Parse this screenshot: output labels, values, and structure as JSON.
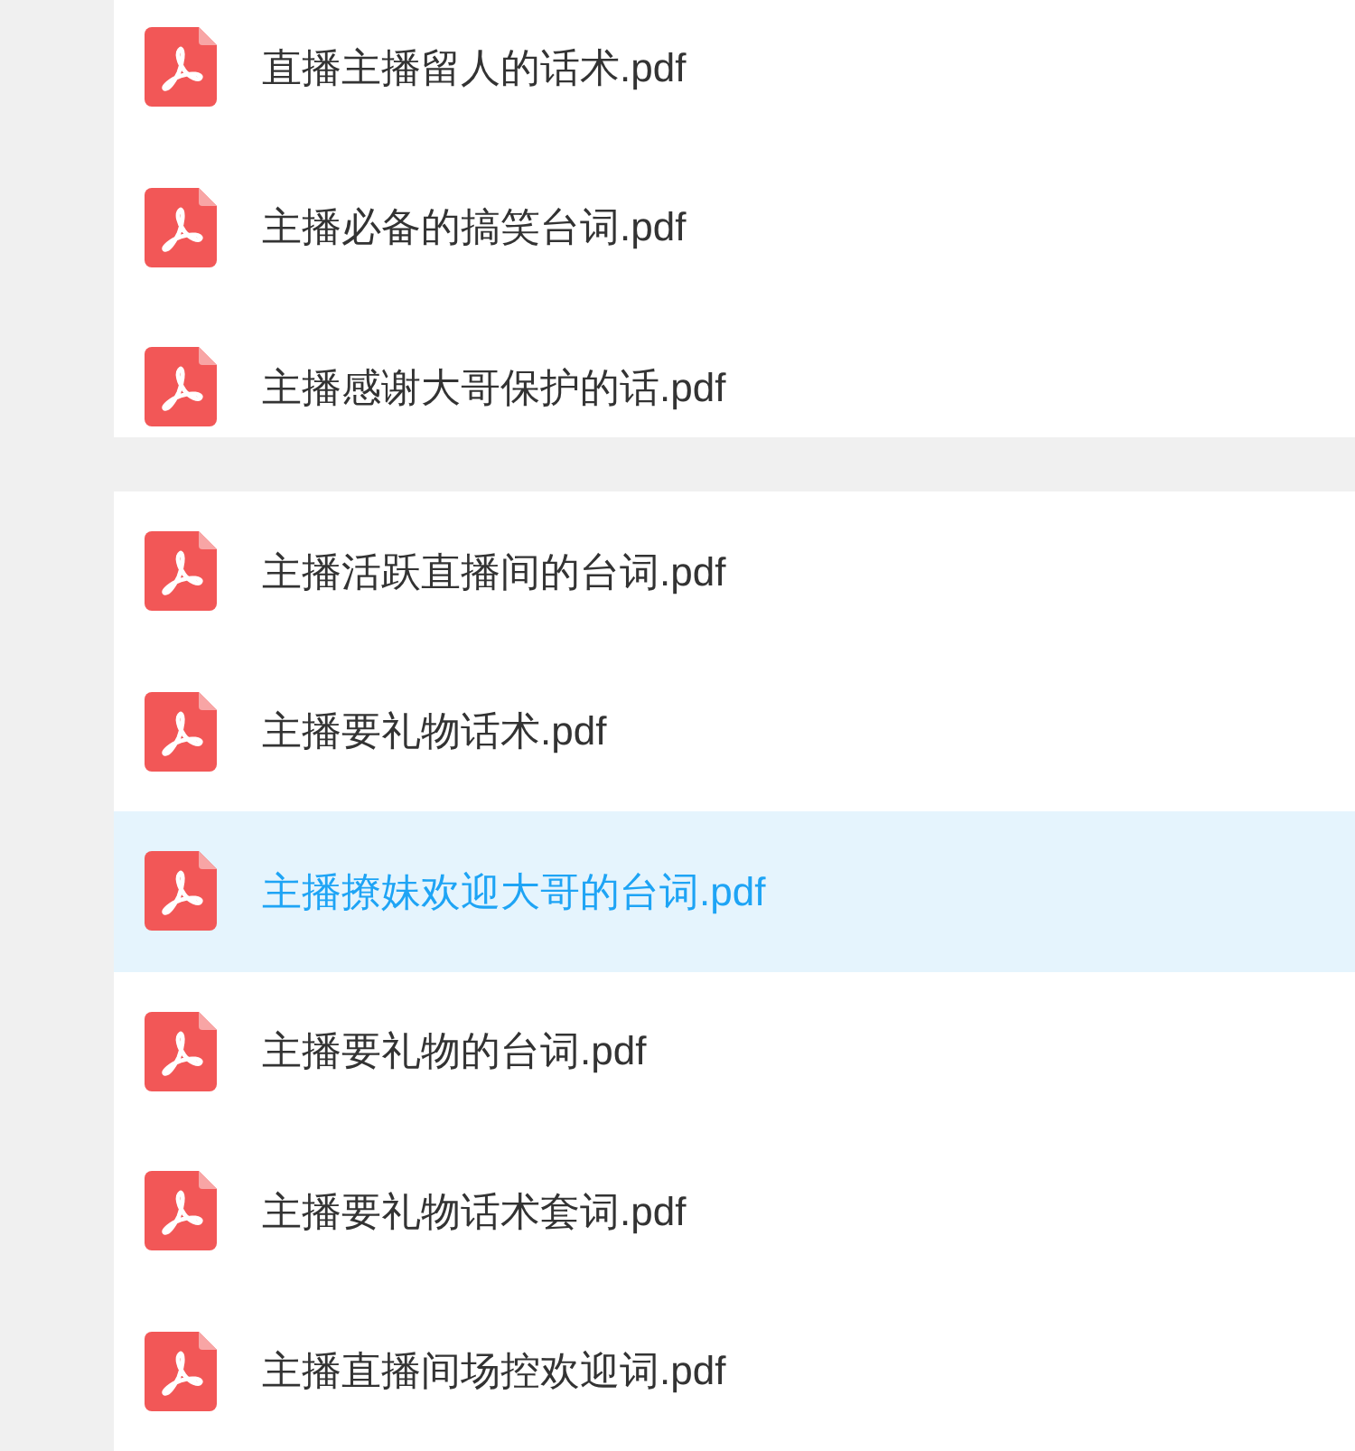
{
  "groups": [
    {
      "files": [
        {
          "name": "直播主播留人的话术.pdf",
          "selected": false
        },
        {
          "name": "主播必备的搞笑台词.pdf",
          "selected": false
        },
        {
          "name": "主播感谢大哥保护的话.pdf",
          "selected": false
        }
      ]
    },
    {
      "files": [
        {
          "name": "主播活跃直播间的台词.pdf",
          "selected": false
        },
        {
          "name": "主播要礼物话术.pdf",
          "selected": false
        },
        {
          "name": "主播撩妹欢迎大哥的台词.pdf",
          "selected": true
        },
        {
          "name": "主播要礼物的台词.pdf",
          "selected": false
        },
        {
          "name": "主播要礼物话术套词.pdf",
          "selected": false
        },
        {
          "name": "主播直播间场控欢迎词.pdf",
          "selected": false
        }
      ]
    }
  ]
}
